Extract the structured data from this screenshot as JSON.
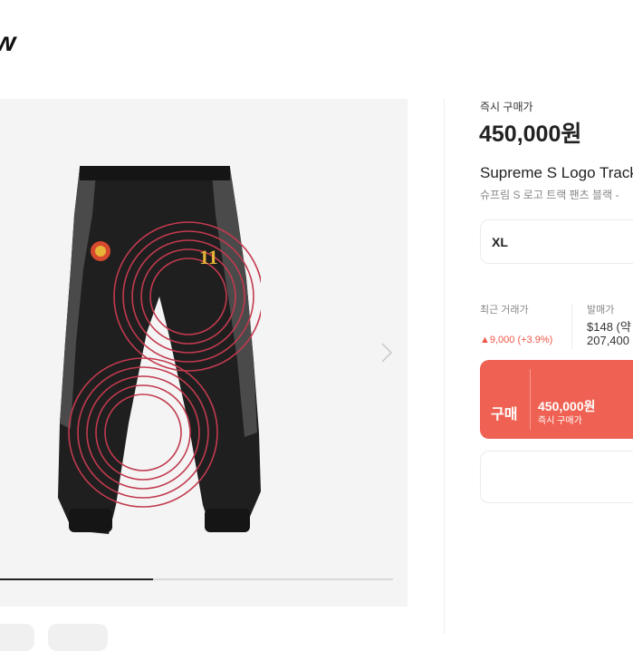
{
  "brand": {
    "logo_text": "w"
  },
  "product": {
    "price_label": "즉시 구매가",
    "price": "450,000원",
    "title": "Supreme S Logo Track",
    "subtitle": "슈프림 S 로고 트랙 팬츠 블랙 -",
    "size": "XL",
    "image_icon": "track-pants-image"
  },
  "market": {
    "recent_label": "최근 거래가",
    "recent_change": "▲9,000 (+3.9%)",
    "release_label": "발매가",
    "release_usd": "$148 (약",
    "release_krw": "207,400"
  },
  "actions": {
    "buy_label": "구매",
    "buy_price": "450,000원",
    "buy_sub": "즉시 구매가"
  },
  "gallery": {
    "progress": 0.39
  },
  "colors": {
    "accent": "#ef6253",
    "change_up": "#f15746"
  }
}
